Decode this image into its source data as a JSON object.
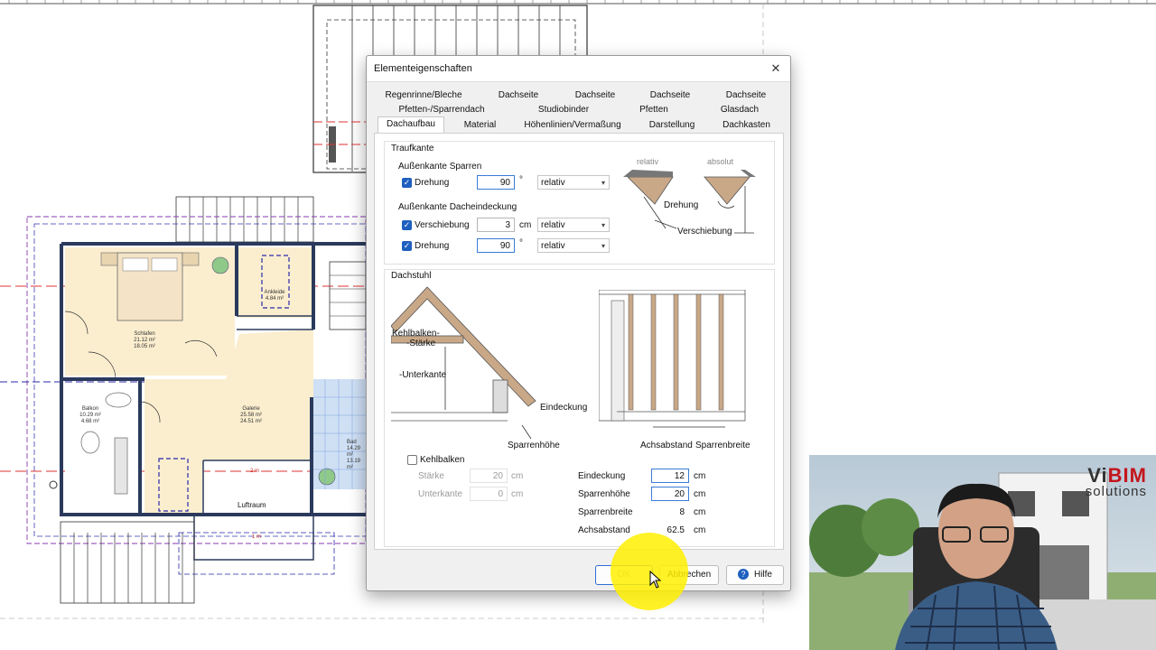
{
  "floorplan": {
    "rooms": [
      {
        "name": "Schlafen",
        "area1": "21.12 m²",
        "area2": "18.05 m²"
      },
      {
        "name": "Ankleide",
        "area1": "4.84 m²",
        "area2": ""
      },
      {
        "name": "Balkon",
        "area1": "10.29 m²",
        "area2": "4.68 m²"
      },
      {
        "name": "Galerie",
        "area1": "25.58 m²",
        "area2": "24.51 m²"
      },
      {
        "name": "Bad",
        "area1": "14.29 m²",
        "area2": "13.19 m²"
      }
    ],
    "luftraum": "Luftraum",
    "dim_2m": "2 m",
    "dim_1m": "1 m"
  },
  "dialog": {
    "title": "Elementeigenschaften",
    "close_glyph": "✕",
    "tabs_row1": [
      "Regenrinne/Bleche",
      "Dachseite",
      "Dachseite",
      "Dachseite",
      "Dachseite"
    ],
    "tabs_row2": [
      "Pfetten-/Sparrendach",
      "Studiobinder",
      "Pfetten",
      "Glasdach"
    ],
    "tabs_row3": [
      "Dachaufbau",
      "Material",
      "Höhenlinien/Vermaßung",
      "Darstellung",
      "Dachkasten"
    ],
    "active_tab": "Dachaufbau",
    "traufkante": {
      "label": "Traufkante",
      "aussen_sparren": "Außenkante Sparren",
      "aussen_dacheindeckung": "Außenkante Dacheindeckung",
      "row1": {
        "check": "Drehung",
        "value": "90",
        "unit": "°",
        "mode": "relativ"
      },
      "row2": {
        "check": "Verschiebung",
        "value": "3",
        "unit": "cm",
        "mode": "relativ"
      },
      "row3": {
        "check": "Drehung",
        "value": "90",
        "unit": "°",
        "mode": "relativ"
      },
      "diagram": {
        "relativ": "relativ",
        "absolut": "absolut",
        "drehung": "Drehung",
        "verschiebung": "Verschiebung"
      }
    },
    "dachstuhl": {
      "label": "Dachstuhl",
      "diagram": {
        "kehlbalken_staerke_1": "Kehlbalken-",
        "kehlbalken_staerke_2": "-Stärke",
        "unterkante": "-Unterkante",
        "eindeckung": "Eindeckung",
        "sparrenhoehe": "Sparrenhöhe",
        "achsabstand": "Achsabstand",
        "sparrenbreite": "Sparrenbreite"
      },
      "kehlbalken_check": "Kehlbalken",
      "staerke": {
        "label": "Stärke",
        "value": "20",
        "unit": "cm"
      },
      "unterkante": {
        "label": "Unterkante",
        "value": "0",
        "unit": "cm"
      },
      "eindeckung": {
        "label": "Eindeckung",
        "value": "12",
        "unit": "cm"
      },
      "sparrenhoehe": {
        "label": "Sparrenhöhe",
        "value": "20",
        "unit": "cm"
      },
      "sparrenbreite": {
        "label": "Sparrenbreite",
        "value": "8",
        "unit": "cm"
      },
      "achsabstand": {
        "label": "Achsabstand",
        "value": "62.5",
        "unit": "cm"
      }
    },
    "buttons": {
      "ok": "OK",
      "cancel": "Abbrechen",
      "help": "Hilfe"
    }
  },
  "video": {
    "logo_line1_a": "Vi",
    "logo_line1_b": "BIM",
    "logo_line2": "solutions"
  }
}
